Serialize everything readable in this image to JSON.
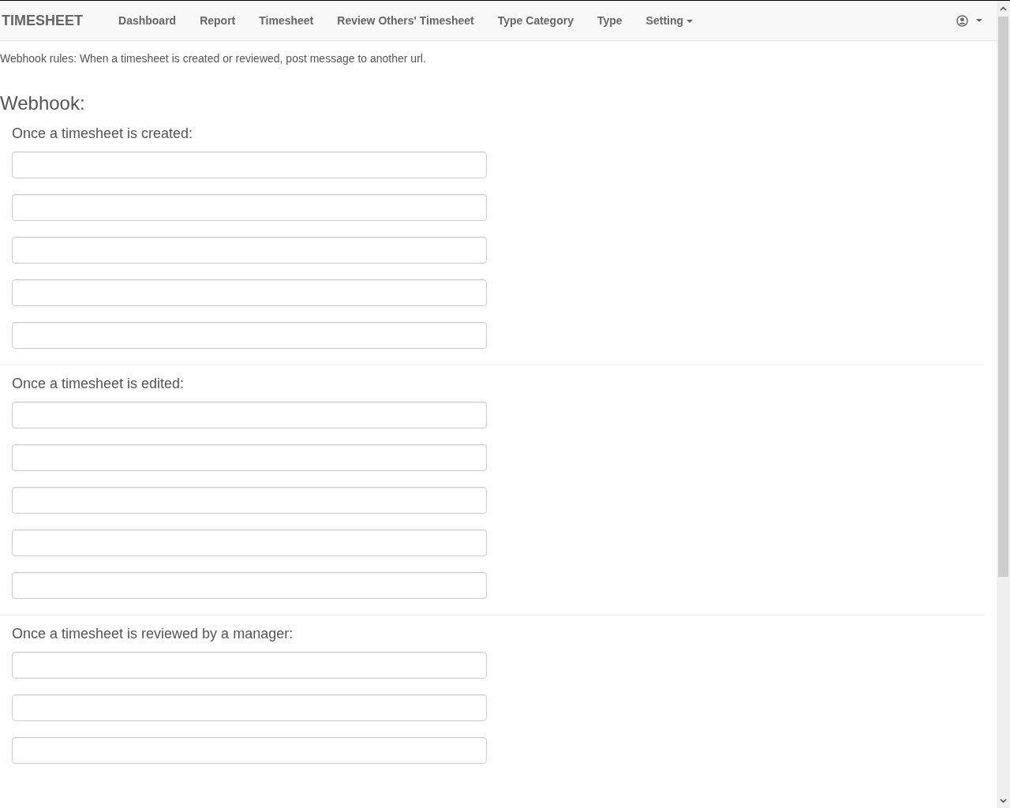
{
  "navbar": {
    "brand": "TIMESHEET",
    "links": [
      {
        "label": "Dashboard",
        "kind": "link"
      },
      {
        "label": "Report",
        "kind": "link"
      },
      {
        "label": "Timesheet",
        "kind": "link"
      },
      {
        "label": "Review Others' Timesheet",
        "kind": "link"
      },
      {
        "label": "Type Category",
        "kind": "link"
      },
      {
        "label": "Type",
        "kind": "link"
      },
      {
        "label": "Setting",
        "kind": "dropdown"
      }
    ]
  },
  "intro": "Webhook rules: When a timesheet is created or reviewed, post message to another url.",
  "heading": "Webhook:",
  "sections": [
    {
      "title": "Once a timesheet is created:",
      "fields": [
        {
          "disabled": false
        },
        {
          "disabled": false
        },
        {
          "disabled": false
        },
        {
          "disabled": false
        },
        {
          "disabled": false
        }
      ]
    },
    {
      "title": "Once a timesheet is edited:",
      "fields": [
        {
          "disabled": false
        },
        {
          "disabled": false
        },
        {
          "disabled": false
        },
        {
          "disabled": false
        },
        {
          "disabled": false
        }
      ]
    },
    {
      "title": "Once a timesheet is reviewed by a manager:",
      "fields": [
        {
          "disabled": false
        },
        {
          "disabled": false
        },
        {
          "disabled": false
        }
      ]
    }
  ]
}
